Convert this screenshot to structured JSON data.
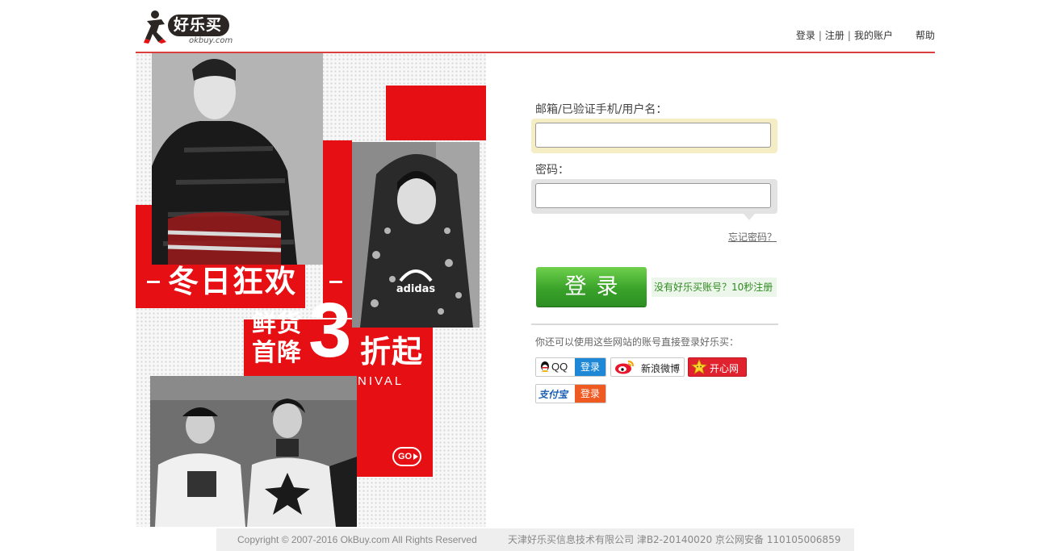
{
  "header": {
    "logo_text": "好乐买",
    "logo_domain": "okbuy.com",
    "nav": [
      {
        "label": "登录"
      },
      {
        "label": "注册"
      },
      {
        "label": "我的账户"
      },
      {
        "label": "帮助"
      }
    ]
  },
  "banner": {
    "title": "冬日狂欢",
    "line1": "鲜货",
    "line2": "首降",
    "big_number": "3",
    "suffix": "折起",
    "subtitle": "WINTER CARNIVAL",
    "go_label": "GO",
    "brand_mark": "adidas"
  },
  "login_form": {
    "username_label": "邮箱/已验证手机/用户名：",
    "username_value": "",
    "password_label": "密码：",
    "password_value": "",
    "forgot_link": "忘记密码？",
    "submit_label": "登录",
    "register_link": "没有好乐买账号？10秒注册",
    "other_login_text": "你还可以使用这些网站的账号直接登录好乐买：",
    "sns": [
      {
        "name": "QQ",
        "action": "登录",
        "color": "#1e88d6"
      },
      {
        "name": "新浪微博",
        "color": "#e6162d"
      },
      {
        "name": "开心网",
        "color": "#e0212e"
      },
      {
        "name": "支付宝",
        "action": "登录",
        "color": "#ef5a23"
      }
    ]
  },
  "footer": {
    "copyright": "Copyright © 2007-2016 OkBuy.com All Rights Reserved",
    "company": "天津好乐买信息技术有限公司  津B2-20140020  京公网安备 110105006859"
  },
  "colors": {
    "accent_red": "#e60f13",
    "header_line": "#d9403c",
    "login_green": "#3aa32a",
    "focus_field_bg": "#f5edc4"
  }
}
